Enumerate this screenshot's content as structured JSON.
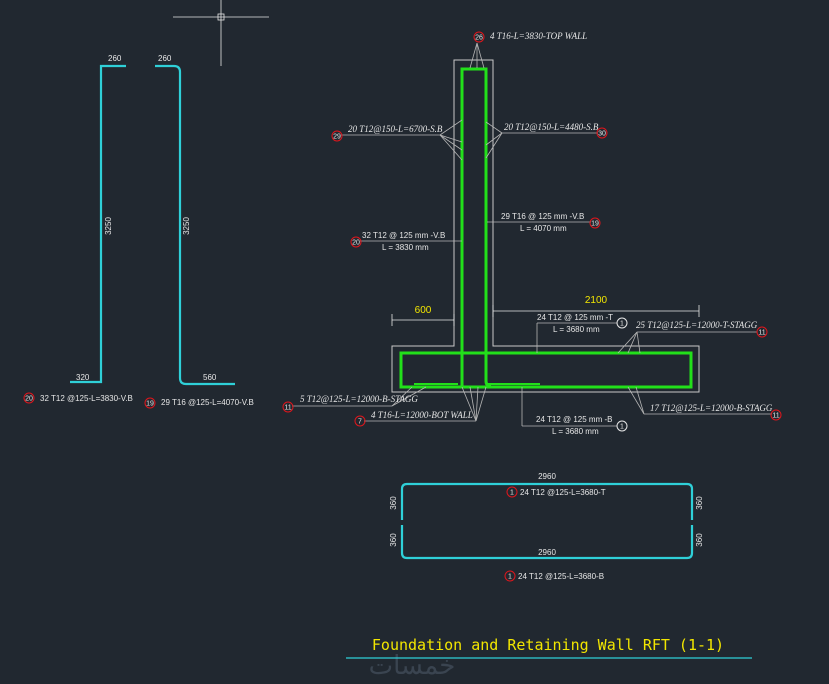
{
  "drawing": {
    "title": "Foundation and Retaining Wall RFT (1-1)",
    "watermark": "خمسات"
  },
  "bar_schedule": {
    "bar20": {
      "top_dim": "260",
      "height_dim": "3250",
      "bottom_dim": "320",
      "mark": "20",
      "label": "32 T12 @125-L=3830-V.B"
    },
    "bar19": {
      "top_dim": "260",
      "height_dim": "3250",
      "bottom_dim": "560",
      "mark": "19",
      "label": "29 T16 @125-L=4070-V.B"
    }
  },
  "section": {
    "dim_toe": "600",
    "dim_heel": "2100",
    "callouts": {
      "top_wall": {
        "mark": "26",
        "text": "4 T16-L=3830-TOP WALL"
      },
      "sb_left": {
        "mark": "29",
        "text": "20 T12@150-L=6700-S.B"
      },
      "sb_right": {
        "mark": "30",
        "text": "20 T12@150-L=4480-S.B"
      },
      "vb_right": {
        "mark": "19",
        "line1": "29 T16 @ 125 mm -V.B",
        "line2": "L = 4070 mm"
      },
      "vb_left": {
        "mark": "20",
        "line1": "32 T12 @ 125 mm -V.B",
        "line2": "L = 3830 mm"
      },
      "top_mesh": {
        "mark": "1",
        "line1": "24 T12 @ 125 mm -T",
        "line2": "L = 3680 mm"
      },
      "t_stagg": {
        "mark": "11",
        "text": "25 T12@125-L=12000-T-STAGG"
      },
      "b_stagg_left": {
        "mark": "11",
        "text": "5 T12@125-L=12000-B-STAGG"
      },
      "bot_wall": {
        "mark": "7",
        "text": "4 T16-L=12000-BOT WALL"
      },
      "bot_mesh": {
        "mark": "1",
        "line1": "24 T12 @ 125 mm -B",
        "line2": "L = 3680 mm"
      },
      "b_stagg_right": {
        "mark": "11",
        "text": "17 T12@125-L=12000-B-STAGG"
      }
    }
  },
  "mesh_bars": {
    "top": {
      "length_dim": "2960",
      "leg_left": "360",
      "leg_right": "360",
      "mark": "1",
      "label": "24 T12 @125-L=3680-T"
    },
    "bottom": {
      "length_dim": "2960",
      "leg_left": "360",
      "leg_right": "360",
      "mark": "1",
      "label": "24 T12 @125-L=3680-B"
    }
  },
  "colors": {
    "background": "#212830",
    "rebar_schedule": "#2fd0d8",
    "rebar_section": "#22e01a",
    "title": "#f2e600",
    "mark_circle": "#e0161c"
  }
}
